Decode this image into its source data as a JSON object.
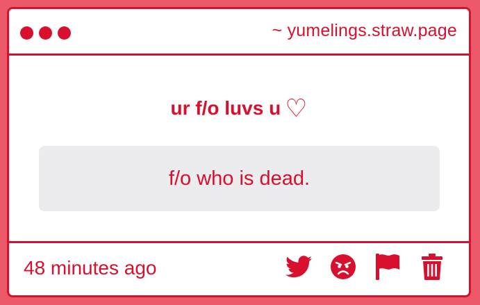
{
  "header": {
    "url": "~ yumelings.straw.page"
  },
  "question": {
    "text": "ur f/o luvs u",
    "heart": "♡"
  },
  "answer": {
    "text": "f/o who is dead."
  },
  "footer": {
    "timestamp": "48 minutes ago",
    "actions": [
      {
        "icon": "twitter-icon"
      },
      {
        "icon": "angry-face-icon"
      },
      {
        "icon": "flag-icon"
      },
      {
        "icon": "trash-icon"
      }
    ]
  },
  "colors": {
    "accent": "#d8102e",
    "page_background": "#ec5a6a",
    "card_background": "#ffffff",
    "answer_background": "#ecebed"
  }
}
